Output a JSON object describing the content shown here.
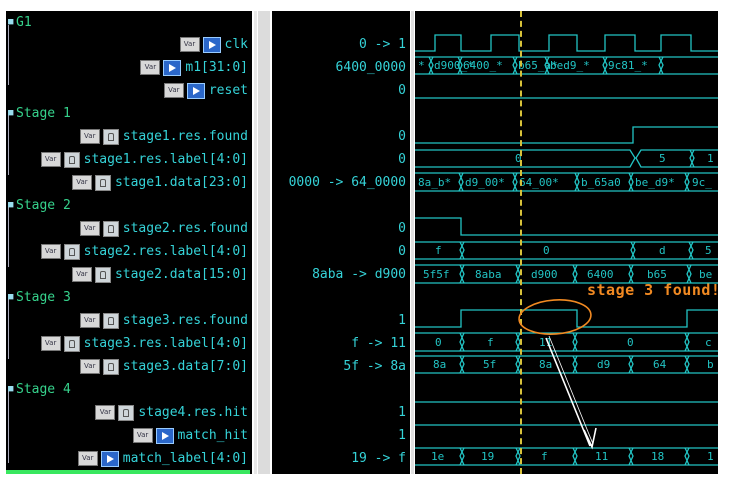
{
  "colors": {
    "group": "#36d28c",
    "signal": "#35d3d8",
    "wave": "#22c4c4",
    "annotation": "#f28a22",
    "cursor": "#d7c23a"
  },
  "groups": [
    {
      "label": "G1"
    },
    {
      "label": "Stage 1"
    },
    {
      "label": "Stage 2"
    },
    {
      "label": "Stage 3"
    },
    {
      "label": "Stage 4"
    }
  ],
  "signals": {
    "clk": {
      "name": "clk",
      "badge": "Var",
      "icon": "input-arrow-icon",
      "value": "0 -> 1"
    },
    "m1": {
      "name": "m1[31:0]",
      "badge": "Var",
      "icon": "input-arrow-icon",
      "value": "6400_0000"
    },
    "reset": {
      "name": "reset",
      "badge": "Var",
      "icon": "input-arrow-icon",
      "value": "0"
    },
    "s1_found": {
      "name": "stage1.res.found",
      "badge": "Var",
      "icon": "lock-icon",
      "value": "0"
    },
    "s1_label": {
      "name": "stage1.res.label[4:0]",
      "badge": "Var",
      "icon": "lock-icon",
      "value": "0"
    },
    "s1_data": {
      "name": "stage1.data[23:0]",
      "badge": "Var",
      "icon": "lock-icon",
      "value": "0000 -> 64_0000"
    },
    "s2_found": {
      "name": "stage2.res.found",
      "badge": "Var",
      "icon": "lock-icon",
      "value": "0"
    },
    "s2_label": {
      "name": "stage2.res.label[4:0]",
      "badge": "Var",
      "icon": "lock-icon",
      "value": "0"
    },
    "s2_data": {
      "name": "stage2.data[15:0]",
      "badge": "Var",
      "icon": "lock-icon",
      "value": "8aba -> d900"
    },
    "s3_found": {
      "name": "stage3.res.found",
      "badge": "Var",
      "icon": "lock-icon",
      "value": "1"
    },
    "s3_label": {
      "name": "stage3.res.label[4:0]",
      "badge": "Var",
      "icon": "lock-icon",
      "value": "f -> 11"
    },
    "s3_data": {
      "name": "stage3.data[7:0]",
      "badge": "Var",
      "icon": "lock-icon",
      "value": "5f -> 8a"
    },
    "s4_hit": {
      "name": "stage4.res.hit",
      "badge": "Var",
      "icon": "lock-icon",
      "value": "1"
    },
    "match_hit": {
      "name": "match_hit",
      "badge": "Var",
      "icon": "output-arrow-icon",
      "value": "1"
    },
    "match_label": {
      "name": "match_label[4:0]",
      "badge": "Var",
      "icon": "output-arrow-icon",
      "value": "19 -> f"
    }
  },
  "waves": {
    "m1_segments": [
      "*",
      "d900_*",
      "6400_*",
      "b65_a*",
      "bed9_*",
      "9c81_*"
    ],
    "s1_label_segments": [
      "0",
      "5",
      "1"
    ],
    "s1_data_segments": [
      "8a_b*",
      "d9_00*",
      "64_00*",
      "b_65a0",
      "be_d9*",
      "9c_"
    ],
    "s2_label_segments": [
      "f",
      "0",
      "d",
      "5"
    ],
    "s2_data_segments": [
      "5f5f",
      "8aba",
      "d900",
      "6400",
      "b65",
      "be"
    ],
    "s3_label_segments": [
      "0",
      "f",
      "11",
      "0",
      "c"
    ],
    "s3_data_segments": [
      "8a",
      "5f",
      "8a",
      "d9",
      "64",
      "b"
    ],
    "match_label_segments": [
      "1e",
      "19",
      "f",
      "11",
      "18",
      "1"
    ]
  },
  "annotation": {
    "text": "stage 3 found!"
  }
}
